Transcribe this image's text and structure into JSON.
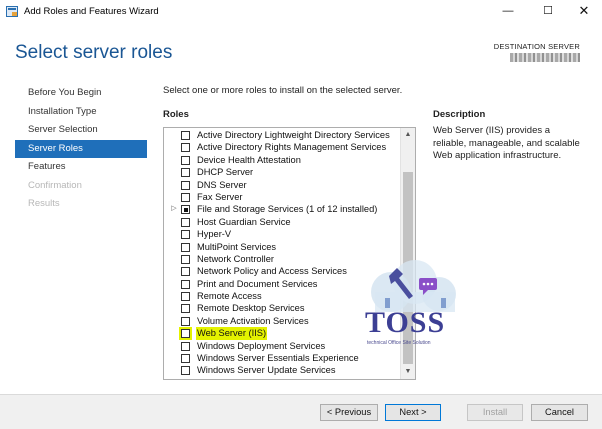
{
  "window": {
    "title": "Add Roles and Features Wizard",
    "minimize_glyph": "—",
    "maximize_glyph": "☐",
    "close_glyph": "✕"
  },
  "page": {
    "heading": "Select server roles",
    "destination_label": "DESTINATION SERVER",
    "intro": "Select one or more roles to install on the selected server."
  },
  "nav": {
    "items": [
      {
        "label": "Before You Begin",
        "state": "normal"
      },
      {
        "label": "Installation Type",
        "state": "normal"
      },
      {
        "label": "Server Selection",
        "state": "normal"
      },
      {
        "label": "Server Roles",
        "state": "active"
      },
      {
        "label": "Features",
        "state": "normal"
      },
      {
        "label": "Confirmation",
        "state": "disabled"
      },
      {
        "label": "Results",
        "state": "disabled"
      }
    ]
  },
  "roles": {
    "header": "Roles",
    "items": [
      {
        "label": "Active Directory Lightweight Directory Services"
      },
      {
        "label": "Active Directory Rights Management Services"
      },
      {
        "label": "Device Health Attestation"
      },
      {
        "label": "DHCP Server"
      },
      {
        "label": "DNS Server"
      },
      {
        "label": "Fax Server"
      },
      {
        "label": "File and Storage Services (1 of 12 installed)"
      },
      {
        "label": "Host Guardian Service"
      },
      {
        "label": "Hyper-V"
      },
      {
        "label": "MultiPoint Services"
      },
      {
        "label": "Network Controller"
      },
      {
        "label": "Network Policy and Access Services"
      },
      {
        "label": "Print and Document Services"
      },
      {
        "label": "Remote Access"
      },
      {
        "label": "Remote Desktop Services"
      },
      {
        "label": "Volume Activation Services"
      },
      {
        "label": "Web Server (IIS)"
      },
      {
        "label": "Windows Deployment Services"
      },
      {
        "label": "Windows Server Essentials Experience"
      },
      {
        "label": "Windows Server Update Services"
      }
    ],
    "expander_glyph": "▷",
    "scroll_up_glyph": "▲",
    "scroll_down_glyph": "▼"
  },
  "description": {
    "header": "Description",
    "text": "Web Server (IIS) provides a reliable, manageable, and scalable Web application infrastructure."
  },
  "buttons": {
    "previous": "< Previous",
    "next": "Next >",
    "install": "Install",
    "cancel": "Cancel"
  },
  "watermark": {
    "word": "TOSS",
    "subtitle": "technical Office Site Solution"
  },
  "colors": {
    "heading": "#1a5694",
    "nav_active": "#1f6fba",
    "highlight": "#e4f200",
    "watermark": "#3c3f94"
  }
}
